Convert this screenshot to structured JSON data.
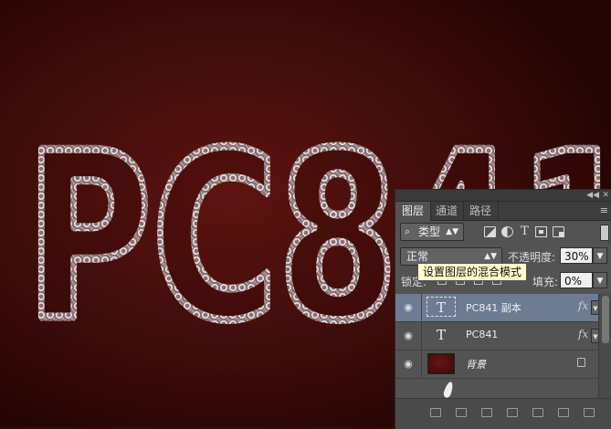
{
  "canvas": {
    "artwork_text": "PC841",
    "background_color": "#3d0c0a"
  },
  "layers_panel": {
    "tabs": [
      {
        "label": "图层",
        "active": true
      },
      {
        "label": "通道",
        "active": false
      },
      {
        "label": "路径",
        "active": false
      }
    ],
    "filter": {
      "kind_label": "类型",
      "icons": [
        "pixel-layer-filter-icon",
        "adjustment-layer-filter-icon",
        "type-layer-filter-icon",
        "shape-layer-filter-icon",
        "smart-object-filter-icon"
      ]
    },
    "blend_mode": "正常",
    "opacity_label": "不透明度:",
    "opacity_value": "30%",
    "lock_label": "锁定:",
    "fill_label": "填充:",
    "fill_value": "0%",
    "tooltip": "设置图层的混合模式",
    "layers": [
      {
        "name": "PC841 副本",
        "type": "text",
        "selected": true,
        "has_fx": true,
        "thumb_glyph": "T"
      },
      {
        "name": "PC841",
        "type": "text",
        "selected": false,
        "has_fx": true,
        "thumb_glyph": "T"
      },
      {
        "name": "背景",
        "type": "background",
        "selected": false,
        "locked": true
      }
    ],
    "selected_color": "#6d7c93"
  }
}
